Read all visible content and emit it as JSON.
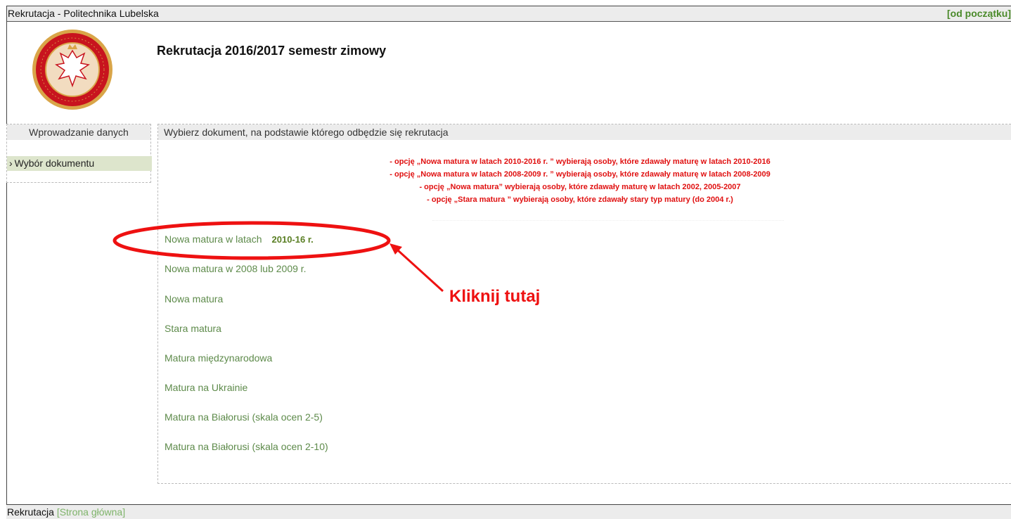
{
  "window": {
    "title": "Rekrutacja - Politechnika Lubelska",
    "restart_link": "[od początku]"
  },
  "logo": {
    "text": "POLITECHNIKA LUBELSKA"
  },
  "header": {
    "heading": "Rekrutacja 2016/2017 semestr zimowy"
  },
  "sidebar": {
    "section_title": "Wprowadzanie danych",
    "items": [
      {
        "marker": "›",
        "label": "Wybór dokumentu"
      }
    ]
  },
  "main": {
    "section_title": "Wybierz dokument, na podstawie którego odbędzie się rekrutacja",
    "notes": [
      "- opcję „Nowa matura w latach 2010-2016 r. ” wybierają osoby, które zdawały maturę w latach 2010-2016",
      "- opcję „Nowa matura w latach 2008-2009 r. ” wybierają osoby, które zdawały maturę w latach 2008-2009",
      "- opcję „Nowa matura” wybierają osoby, które zdawały maturę w latach 2002, 2005-2007",
      "- opcję „Stara matura ” wybierają osoby, które zdawały stary typ matury (do 2004 r.)"
    ],
    "options": [
      {
        "label": "Nowa matura w latach",
        "years": "2010-16 r."
      },
      {
        "label": "Nowa matura w 2008 lub 2009 r."
      },
      {
        "label": "Nowa matura"
      },
      {
        "label": "Stara matura"
      },
      {
        "label": "Matura międzynarodowa"
      },
      {
        "label": "Matura na Ukrainie"
      },
      {
        "label": "Matura na Białorusi (skala ocen 2-5)"
      },
      {
        "label": "Matura na Białorusi (skala ocen 2-10)"
      }
    ]
  },
  "annotation": {
    "text": "Kliknij tutaj",
    "color": "#ee1111"
  },
  "footer": {
    "label": "Rekrutacja",
    "home_link": "[Strona główna]"
  },
  "colors": {
    "link_green": "#5d8a4a",
    "note_red": "#e01010",
    "logo_red": "#c8141e",
    "logo_gold": "#d9a548"
  }
}
